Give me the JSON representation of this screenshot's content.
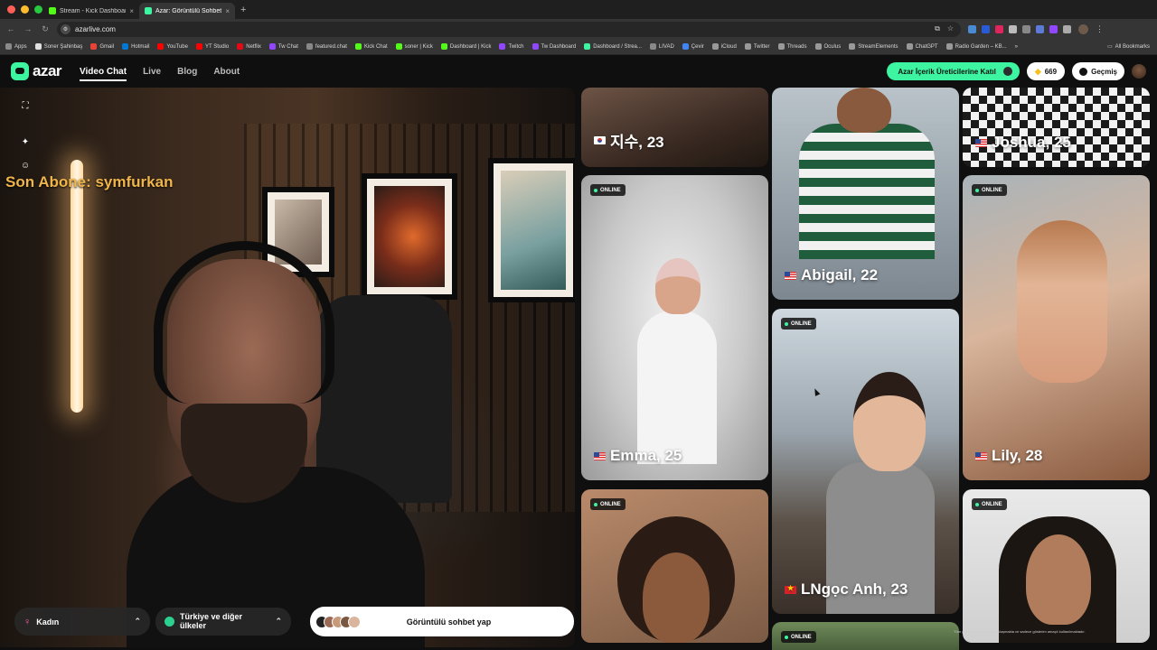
{
  "browser": {
    "tabs": [
      {
        "title": "Stream - Kick Dashboard",
        "favicon_color": "#53fc18",
        "active": false
      },
      {
        "title": "Azar: Görüntülü Sohbet",
        "favicon_color": "#3df5a1",
        "active": true
      }
    ],
    "url": "azarlive.com",
    "bookmarks": [
      {
        "label": "Apps",
        "color": "#8a8a8a"
      },
      {
        "label": "Soner Şahinbaş",
        "color": "#e0e0e0"
      },
      {
        "label": "Gmail",
        "color": "#ea4335"
      },
      {
        "label": "Hotmail",
        "color": "#0078d4"
      },
      {
        "label": "YouTube",
        "color": "#ff0000"
      },
      {
        "label": "YT Studio",
        "color": "#ff0000"
      },
      {
        "label": "Netflix",
        "color": "#e50914"
      },
      {
        "label": "Tw Chat",
        "color": "#9146ff"
      },
      {
        "label": "featured.chat",
        "color": "#888888"
      },
      {
        "label": "Kick Chat",
        "color": "#53fc18"
      },
      {
        "label": "soner | Kick",
        "color": "#53fc18"
      },
      {
        "label": "Dashboard | Kick",
        "color": "#53fc18"
      },
      {
        "label": "Twitch",
        "color": "#9146ff"
      },
      {
        "label": "Tw Dashboard",
        "color": "#9146ff"
      },
      {
        "label": "Dashboard / Strea...",
        "color": "#3df5a1"
      },
      {
        "label": "LIVAD",
        "color": "#888888"
      },
      {
        "label": "Çevir",
        "color": "#4285f4"
      },
      {
        "label": "iCloud",
        "color": "#999999"
      },
      {
        "label": "Twitter",
        "color": "#999999"
      },
      {
        "label": "Threads",
        "color": "#999999"
      },
      {
        "label": "Oculus",
        "color": "#999999"
      },
      {
        "label": "StreamElements",
        "color": "#999999"
      },
      {
        "label": "ChatGPT",
        "color": "#999999"
      },
      {
        "label": "Radio Garden – KB...",
        "color": "#999999"
      }
    ],
    "all_bookmarks": "All Bookmarks"
  },
  "azar": {
    "logo": "azar",
    "nav": [
      {
        "label": "Video Chat",
        "active": true
      },
      {
        "label": "Live",
        "active": false
      },
      {
        "label": "Blog",
        "active": false
      },
      {
        "label": "About",
        "active": false
      }
    ],
    "creator_cta": "Azar İçerik Üreticilerine Katıl",
    "gems": "669",
    "history": "Geçmiş",
    "accent": "#3df5a1",
    "camera": {
      "overlay_text": "Son Abone: symfurkan"
    },
    "filters": {
      "gender": "Kadın",
      "region": "Türkiye ve diğer ülkeler"
    },
    "start_button": "Görüntülü sohbet yap",
    "online_label": "ONLINE",
    "profiles": [
      {
        "name": "지수, 23",
        "flag": "kr",
        "online": false
      },
      {
        "name": "Joshua, 25",
        "flag": "us",
        "online": false
      },
      {
        "name": "Abigail, 22",
        "flag": "us",
        "online": false
      },
      {
        "name": "Emma, 25",
        "flag": "us",
        "online": true
      },
      {
        "name": "Lily, 28",
        "flag": "us",
        "online": true
      },
      {
        "name": "LNgọc Anh, 23",
        "flag": "vn",
        "online": true
      },
      {
        "name": "",
        "flag": "",
        "online": true
      },
      {
        "name": "",
        "flag": "",
        "online": true
      },
      {
        "name": "",
        "flag": "",
        "online": true
      }
    ],
    "disclaimer": "Tüm görseller modellerden oluşmakta ve sadece gösterim amaçlı kullanılmaktadır."
  }
}
